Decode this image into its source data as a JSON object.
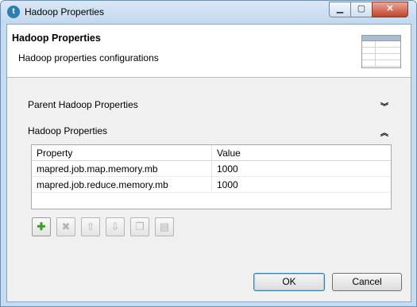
{
  "window": {
    "title": "Hadoop Properties",
    "app_icon": "talend-icon"
  },
  "header": {
    "title": "Hadoop Properties",
    "subtitle": "Hadoop properties configurations",
    "image": "table-icon"
  },
  "sections": {
    "parent": {
      "label": "Parent Hadoop Properties",
      "state": "collapsed"
    },
    "hadoop": {
      "label": "Hadoop Properties",
      "state": "expanded"
    }
  },
  "table": {
    "columns": [
      "Property",
      "Value"
    ],
    "rows": [
      {
        "property": "mapred.job.map.memory.mb",
        "value": "1000"
      },
      {
        "property": "mapred.job.reduce.memory.mb",
        "value": "1000"
      }
    ]
  },
  "toolbar": [
    "add-icon",
    "remove-icon",
    "move-up-icon",
    "move-down-icon",
    "copy-icon",
    "paste-icon"
  ],
  "buttons": {
    "ok": "OK",
    "cancel": "Cancel"
  }
}
